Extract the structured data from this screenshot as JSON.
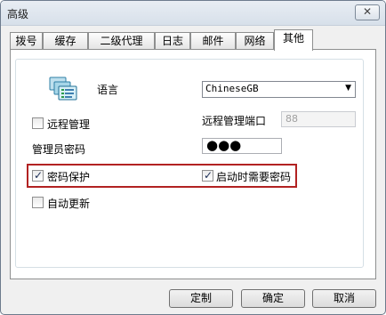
{
  "window": {
    "title": "高级",
    "close_glyph": "✕"
  },
  "tabs": [
    {
      "label": "拨号",
      "active": false
    },
    {
      "label": "缓存",
      "active": false
    },
    {
      "label": "二级代理",
      "active": false
    },
    {
      "label": "日志",
      "active": false
    },
    {
      "label": "邮件",
      "active": false
    },
    {
      "label": "网络",
      "active": false
    },
    {
      "label": "其他",
      "active": true
    }
  ],
  "settings": {
    "language_label": "语言",
    "language_value": "ChineseGB",
    "remote_manage_label": "远程管理",
    "remote_manage_checked": false,
    "remote_port_label": "远程管理端口",
    "remote_port_value": "88",
    "admin_password_label": "管理员密码",
    "admin_password_mask": "●●●",
    "password_protect_label": "密码保护",
    "password_protect_checked": true,
    "startup_password_label": "启动时需要密码",
    "startup_password_checked": true,
    "auto_update_label": "自动更新",
    "auto_update_checked": false
  },
  "buttons": {
    "customize": "定制",
    "ok": "确定",
    "cancel": "取消"
  },
  "icons": {
    "language": "language-stack-icon",
    "check": "checkmark-icon",
    "dropdown": "chevron-down-icon"
  },
  "colors": {
    "highlight": "#b22222",
    "check": "#1b2d55"
  },
  "glyphs": {
    "check": "✓",
    "dropdown": "▼"
  }
}
